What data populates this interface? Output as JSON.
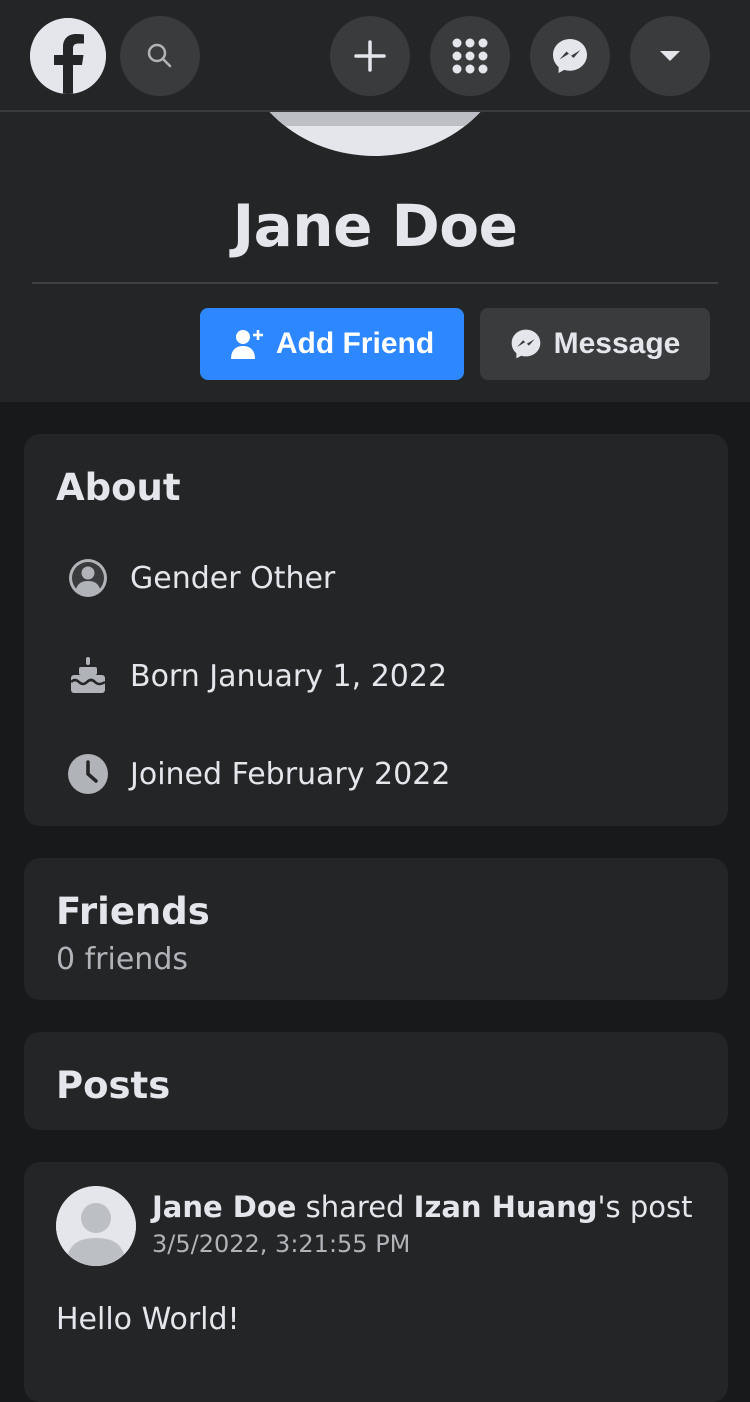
{
  "topbar": {
    "icons": [
      "facebook-logo-icon",
      "search-icon",
      "plus-icon",
      "menu-grid-icon",
      "messenger-icon",
      "caret-down-icon"
    ]
  },
  "profile": {
    "name": "Jane Doe",
    "add_friend_label": "Add Friend",
    "message_label": "Message"
  },
  "about": {
    "title": "About",
    "items": [
      {
        "icon": "user-circle-icon",
        "text": "Gender Other"
      },
      {
        "icon": "cake-icon",
        "text": "Born January 1, 2022"
      },
      {
        "icon": "clock-icon",
        "text": "Joined February 2022"
      }
    ]
  },
  "friends": {
    "title": "Friends",
    "count_text": "0 friends"
  },
  "posts": {
    "title": "Posts",
    "items": [
      {
        "author": "Jane Doe",
        "verb": " shared ",
        "shared_from": "Izan Huang",
        "suffix": "'s post",
        "timestamp": "3/5/2022, 3:21:55 PM",
        "body": "Hello World!"
      }
    ]
  },
  "colors": {
    "accent": "#2d88ff",
    "background": "#18191a",
    "surface": "#242526",
    "control": "#3a3b3c",
    "text_primary": "#e4e6eb",
    "text_secondary": "#b0b3b8"
  }
}
